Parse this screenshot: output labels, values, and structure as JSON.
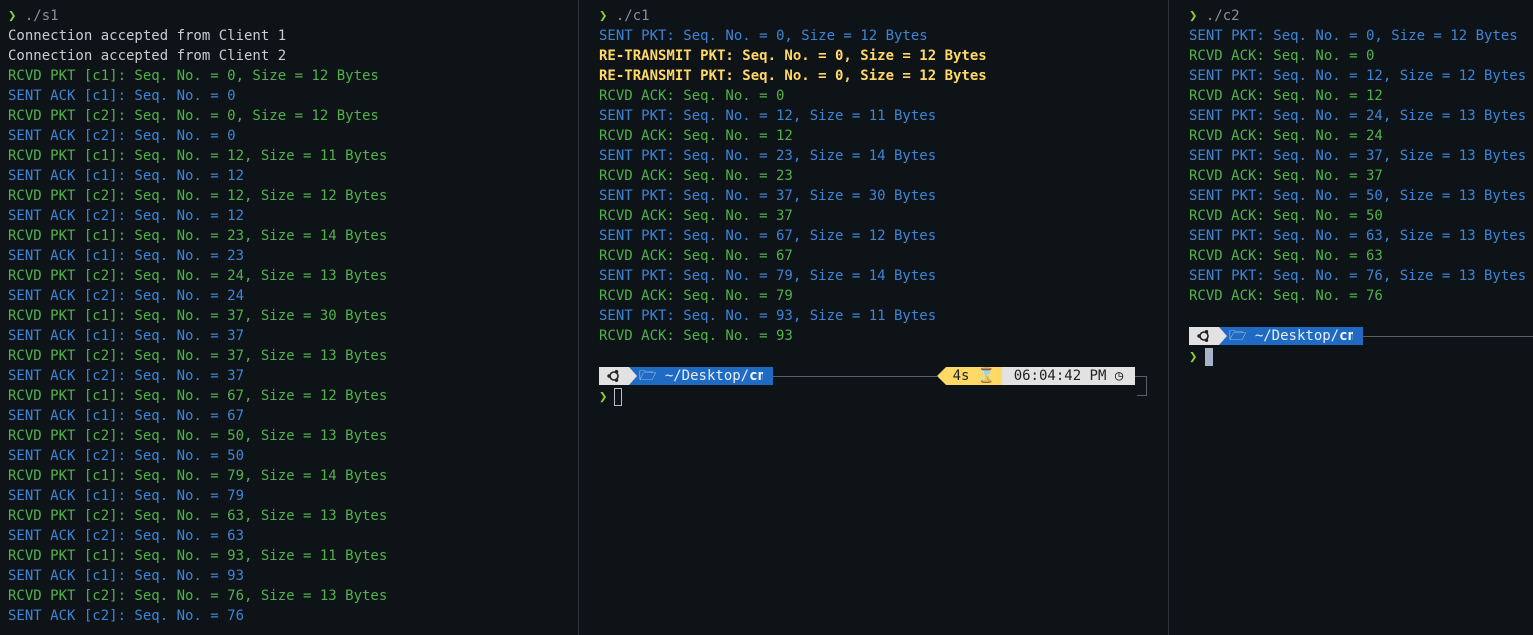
{
  "panes": {
    "s1": {
      "command": "./s1",
      "lines": [
        {
          "text": "Connection accepted from Client 1",
          "color": "#c8cdd2"
        },
        {
          "text": "Connection accepted from Client 2",
          "color": "#c8cdd2"
        },
        {
          "text": "RCVD PKT [c1]: Seq. No. = 0, Size = 12 Bytes",
          "color": "#52b24a"
        },
        {
          "text": "SENT ACK [c1]: Seq. No. = 0",
          "color": "#3f85d6"
        },
        {
          "text": "RCVD PKT [c2]: Seq. No. = 0, Size = 12 Bytes",
          "color": "#52b24a"
        },
        {
          "text": "SENT ACK [c2]: Seq. No. = 0",
          "color": "#3f85d6"
        },
        {
          "text": "RCVD PKT [c1]: Seq. No. = 12, Size = 11 Bytes",
          "color": "#52b24a"
        },
        {
          "text": "SENT ACK [c1]: Seq. No. = 12",
          "color": "#3f85d6"
        },
        {
          "text": "RCVD PKT [c2]: Seq. No. = 12, Size = 12 Bytes",
          "color": "#52b24a"
        },
        {
          "text": "SENT ACK [c2]: Seq. No. = 12",
          "color": "#3f85d6"
        },
        {
          "text": "RCVD PKT [c1]: Seq. No. = 23, Size = 14 Bytes",
          "color": "#52b24a"
        },
        {
          "text": "SENT ACK [c1]: Seq. No. = 23",
          "color": "#3f85d6"
        },
        {
          "text": "RCVD PKT [c2]: Seq. No. = 24, Size = 13 Bytes",
          "color": "#52b24a"
        },
        {
          "text": "SENT ACK [c2]: Seq. No. = 24",
          "color": "#3f85d6"
        },
        {
          "text": "RCVD PKT [c1]: Seq. No. = 37, Size = 30 Bytes",
          "color": "#52b24a"
        },
        {
          "text": "SENT ACK [c1]: Seq. No. = 37",
          "color": "#3f85d6"
        },
        {
          "text": "RCVD PKT [c2]: Seq. No. = 37, Size = 13 Bytes",
          "color": "#52b24a"
        },
        {
          "text": "SENT ACK [c2]: Seq. No. = 37",
          "color": "#3f85d6"
        },
        {
          "text": "RCVD PKT [c1]: Seq. No. = 67, Size = 12 Bytes",
          "color": "#52b24a"
        },
        {
          "text": "SENT ACK [c1]: Seq. No. = 67",
          "color": "#3f85d6"
        },
        {
          "text": "RCVD PKT [c2]: Seq. No. = 50, Size = 13 Bytes",
          "color": "#52b24a"
        },
        {
          "text": "SENT ACK [c2]: Seq. No. = 50",
          "color": "#3f85d6"
        },
        {
          "text": "RCVD PKT [c1]: Seq. No. = 79, Size = 14 Bytes",
          "color": "#52b24a"
        },
        {
          "text": "SENT ACK [c1]: Seq. No. = 79",
          "color": "#3f85d6"
        },
        {
          "text": "RCVD PKT [c2]: Seq. No. = 63, Size = 13 Bytes",
          "color": "#52b24a"
        },
        {
          "text": "SENT ACK [c2]: Seq. No. = 63",
          "color": "#3f85d6"
        },
        {
          "text": "RCVD PKT [c1]: Seq. No. = 93, Size = 11 Bytes",
          "color": "#52b24a"
        },
        {
          "text": "SENT ACK [c1]: Seq. No. = 93",
          "color": "#3f85d6"
        },
        {
          "text": "RCVD PKT [c2]: Seq. No. = 76, Size = 13 Bytes",
          "color": "#52b24a"
        },
        {
          "text": "SENT ACK [c2]: Seq. No. = 76",
          "color": "#3f85d6"
        }
      ]
    },
    "c1": {
      "command": "./c1",
      "lines": [
        {
          "text": "SENT PKT: Seq. No. = 0, Size = 12 Bytes",
          "color": "#3f85d6"
        },
        {
          "text": "RE-TRANSMIT PKT: Seq. No. = 0, Size = 12 Bytes",
          "color": "#ffd866"
        },
        {
          "text": "RE-TRANSMIT PKT: Seq. No. = 0, Size = 12 Bytes",
          "color": "#ffd866"
        },
        {
          "text": "RCVD ACK: Seq. No. = 0",
          "color": "#52b24a"
        },
        {
          "text": "SENT PKT: Seq. No. = 12, Size = 11 Bytes",
          "color": "#3f85d6"
        },
        {
          "text": "RCVD ACK: Seq. No. = 12",
          "color": "#52b24a"
        },
        {
          "text": "SENT PKT: Seq. No. = 23, Size = 14 Bytes",
          "color": "#3f85d6"
        },
        {
          "text": "RCVD ACK: Seq. No. = 23",
          "color": "#52b24a"
        },
        {
          "text": "SENT PKT: Seq. No. = 37, Size = 30 Bytes",
          "color": "#3f85d6"
        },
        {
          "text": "RCVD ACK: Seq. No. = 37",
          "color": "#52b24a"
        },
        {
          "text": "SENT PKT: Seq. No. = 67, Size = 12 Bytes",
          "color": "#3f85d6"
        },
        {
          "text": "RCVD ACK: Seq. No. = 67",
          "color": "#52b24a"
        },
        {
          "text": "SENT PKT: Seq. No. = 79, Size = 14 Bytes",
          "color": "#3f85d6"
        },
        {
          "text": "RCVD ACK: Seq. No. = 79",
          "color": "#52b24a"
        },
        {
          "text": "SENT PKT: Seq. No. = 93, Size = 11 Bytes",
          "color": "#3f85d6"
        },
        {
          "text": "RCVD ACK: Seq. No. = 93",
          "color": "#52b24a"
        }
      ],
      "prompt": {
        "os_icon": "ubuntu-icon",
        "folder_icon": "folder-open-icon",
        "dir_prefix": "~/Desktop/",
        "dir_name": "cn",
        "duration": "4s",
        "duration_icon": "hourglass-icon",
        "time": "06:04:42 PM",
        "clock_icon": "clock-icon"
      }
    },
    "c2": {
      "command": "./c2",
      "lines": [
        {
          "text": "SENT PKT: Seq. No. = 0, Size = 12 Bytes",
          "color": "#3f85d6"
        },
        {
          "text": "RCVD ACK: Seq. No. = 0",
          "color": "#52b24a"
        },
        {
          "text": "SENT PKT: Seq. No. = 12, Size = 12 Bytes",
          "color": "#3f85d6"
        },
        {
          "text": "RCVD ACK: Seq. No. = 12",
          "color": "#52b24a"
        },
        {
          "text": "SENT PKT: Seq. No. = 24, Size = 13 Bytes",
          "color": "#3f85d6"
        },
        {
          "text": "RCVD ACK: Seq. No. = 24",
          "color": "#52b24a"
        },
        {
          "text": "SENT PKT: Seq. No. = 37, Size = 13 Bytes",
          "color": "#3f85d6"
        },
        {
          "text": "RCVD ACK: Seq. No. = 37",
          "color": "#52b24a"
        },
        {
          "text": "SENT PKT: Seq. No. = 50, Size = 13 Bytes",
          "color": "#3f85d6"
        },
        {
          "text": "RCVD ACK: Seq. No. = 50",
          "color": "#52b24a"
        },
        {
          "text": "SENT PKT: Seq. No. = 63, Size = 13 Bytes",
          "color": "#3f85d6"
        },
        {
          "text": "RCVD ACK: Seq. No. = 63",
          "color": "#52b24a"
        },
        {
          "text": "SENT PKT: Seq. No. = 76, Size = 13 Bytes",
          "color": "#3f85d6"
        },
        {
          "text": "RCVD ACK: Seq. No. = 76",
          "color": "#52b24a"
        }
      ],
      "prompt": {
        "os_icon": "ubuntu-icon",
        "folder_icon": "folder-open-icon",
        "dir_prefix": "~/Desktop/",
        "dir_name": "cn"
      }
    }
  },
  "prompt_symbol": "❯",
  "colors": {
    "background": "#0e1318",
    "received": "#52b24a",
    "sent": "#3f85d6",
    "retransmit": "#ffd866",
    "info": "#c8cdd2",
    "prompt_chevron": "#8fcf3c",
    "dir_segment": "#1f6ac2",
    "os_segment": "#e2e2e2",
    "duration_segment": "#ffd866"
  }
}
